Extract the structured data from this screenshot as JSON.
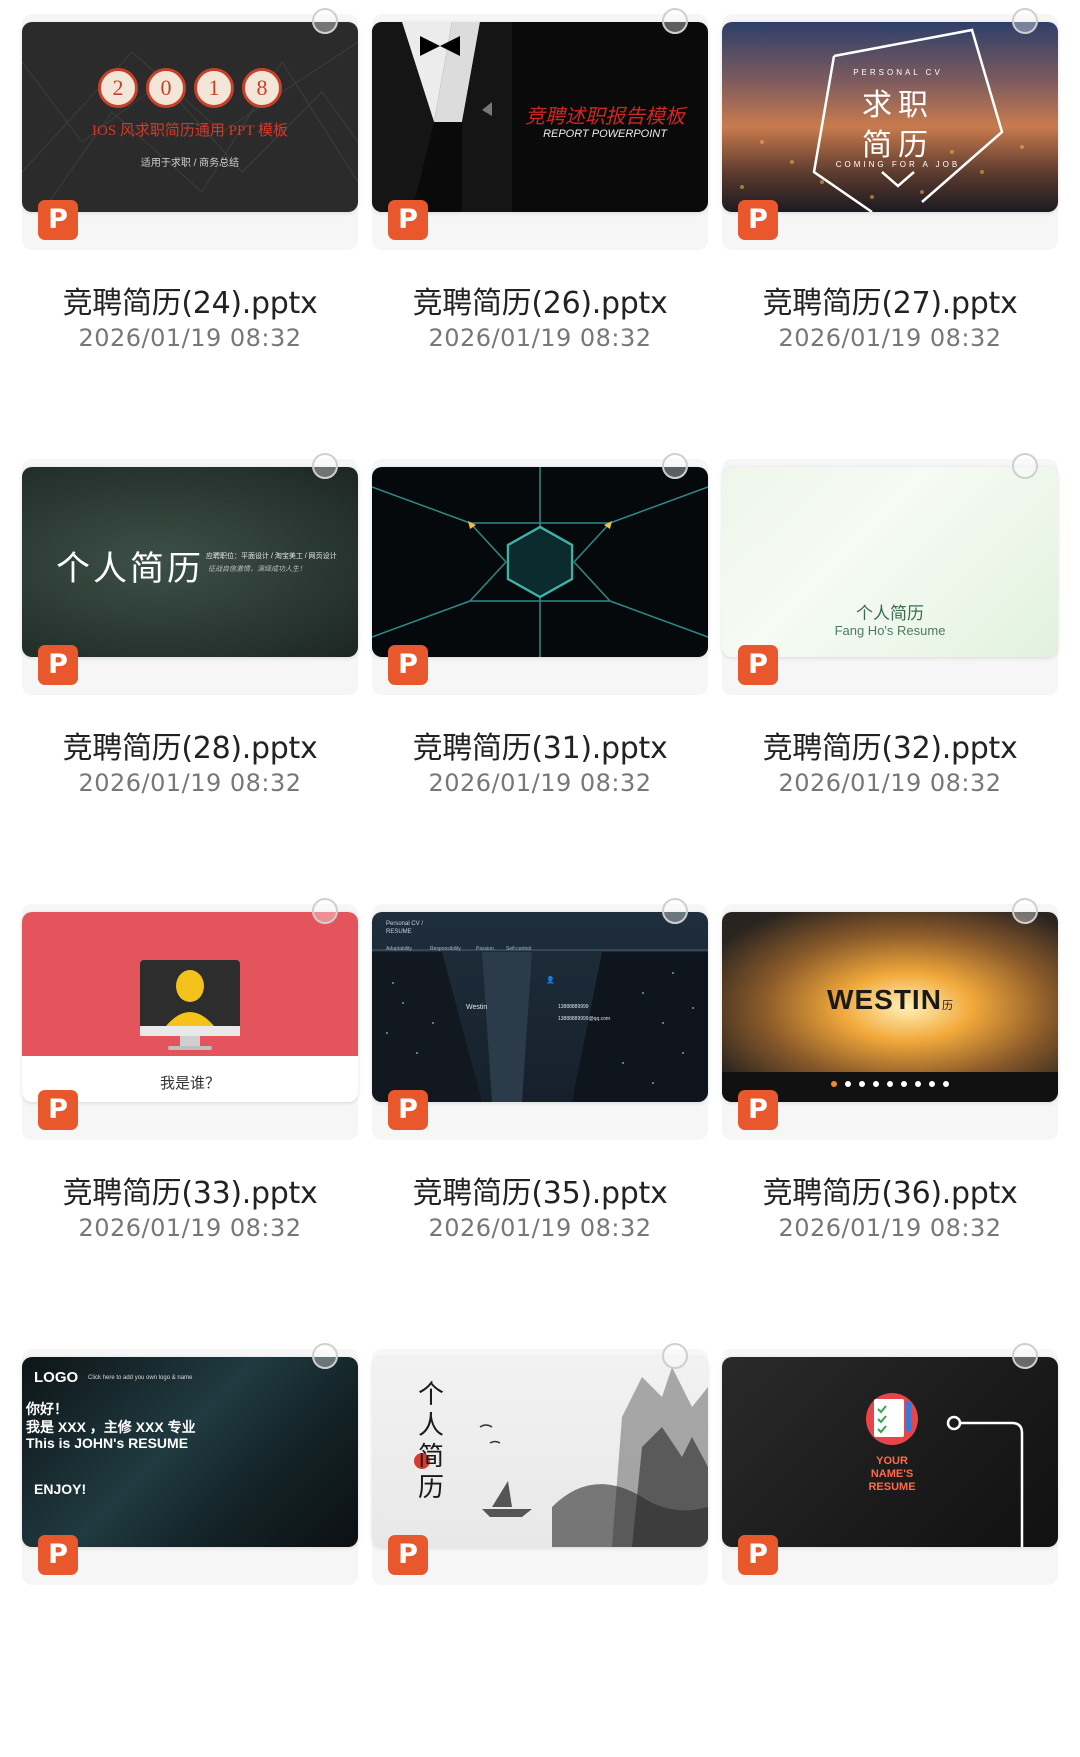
{
  "files": [
    {
      "name": "竞聘简历(24).pptx",
      "date": "2026/01/19 08:32",
      "thumb": {
        "digits": [
          "2",
          "0",
          "1",
          "8"
        ],
        "title": "IOS 风求职简历通用 PPT 模板",
        "subtitle": "适用于求职 / 商务总结"
      }
    },
    {
      "name": "竞聘简历(26).pptx",
      "date": "2026/01/19 08:32",
      "thumb": {
        "title": "竞聘述职报告模板",
        "subtitle": "REPORT POWERPOINT"
      }
    },
    {
      "name": "竞聘简历(27).pptx",
      "date": "2026/01/19 08:32",
      "thumb": {
        "top": "PERSONAL CV",
        "line1": "求职",
        "line2": "简历",
        "bottom": "COMING FOR A JOB"
      }
    },
    {
      "name": "竞聘简历(28).pptx",
      "date": "2026/01/19 08:32",
      "thumb": {
        "title": "个人简历",
        "meta": "应聘职位：平面设计 / 淘宝美工 / 网页设计",
        "slogan": "征战自信激情，演绎成功人生！"
      }
    },
    {
      "name": "竞聘简历(31).pptx",
      "date": "2026/01/19 08:32",
      "thumb": {}
    },
    {
      "name": "竞聘简历(32).pptx",
      "date": "2026/01/19 08:32",
      "thumb": {
        "title": "个人简历",
        "subtitle": "Fang Ho's Resume"
      }
    },
    {
      "name": "竞聘简历(33).pptx",
      "date": "2026/01/19 08:32",
      "thumb": {
        "caption": "我是谁？"
      }
    },
    {
      "name": "竞聘简历(35).pptx",
      "date": "2026/01/19 08:32",
      "thumb": {
        "header": "Personal CV / RESUME",
        "tabs": [
          "Adaptability",
          "Responsibility",
          "Passion",
          "Self-control"
        ],
        "brand": "Westin",
        "phone": "13888889999",
        "email": "13888889999@qq.com"
      }
    },
    {
      "name": "竞聘简历(36).pptx",
      "date": "2026/01/19 08:32",
      "thumb": {
        "title": "WESTIN",
        "suffix": "历"
      }
    },
    {
      "name": "",
      "date": "",
      "thumb": {
        "logo": "LOGO",
        "hint": "Click here to add you own logo & name",
        "l1": "你好！",
        "l2": "我是 XXX ，主修 XXX 专业",
        "l3": "This is JOHN's RESUME",
        "l4": "ENJOY!"
      }
    },
    {
      "name": "",
      "date": "",
      "thumb": {
        "title": "个人简历"
      }
    },
    {
      "name": "",
      "date": "",
      "thumb": {
        "title": "YOUR NAME'S RESUME"
      }
    }
  ],
  "badge_letter": "P",
  "colors": {
    "badge": "#e8582c",
    "filename": "#222222",
    "date": "#777777"
  }
}
